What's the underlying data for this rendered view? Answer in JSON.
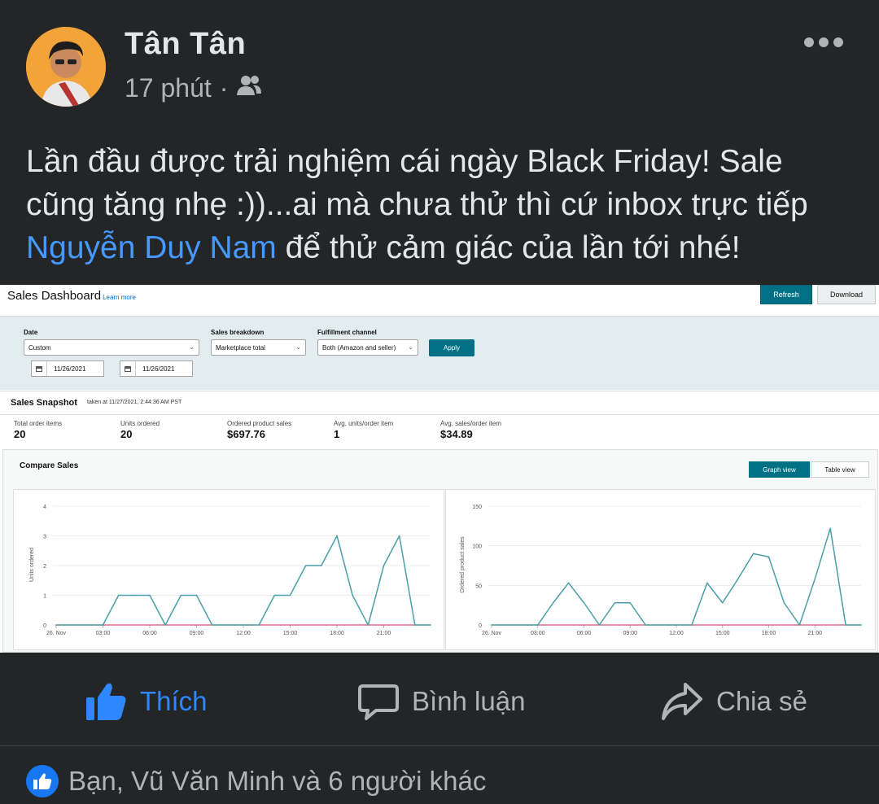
{
  "post": {
    "author": "Tân Tân",
    "time": "17 phút",
    "separator": "·",
    "text_line1": "Lần đầu được trải nghiệm cái ngày Black Friday! Sale",
    "text_line2": "cũng tăng nhẹ :))...ai mà chưa thử thì cứ inbox trực tiếp",
    "mention": "Nguyễn Duy Nam",
    "text_line3_rest": " để thử cảm giác của lần tới nhé!"
  },
  "dashboard": {
    "title": "Sales Dashboard",
    "learn_more": "Learn more",
    "refresh": "Refresh",
    "download": "Download",
    "filters": {
      "date_label": "Date",
      "date_value": "Custom",
      "breakdown_label": "Sales breakdown",
      "breakdown_value": "Marketplace total",
      "channel_label": "Fulfillment channel",
      "channel_value": "Both (Amazon and seller)",
      "apply": "Apply",
      "start_date": "11/26/2021",
      "end_date": "11/26/2021"
    },
    "snapshot": {
      "title": "Sales Snapshot",
      "taken_at": "taken at 11/27/2021, 2:44:36 AM PST",
      "metrics": [
        {
          "label": "Total order items",
          "value": "20"
        },
        {
          "label": "Units ordered",
          "value": "20"
        },
        {
          "label": "Ordered product sales",
          "value": "$697.76"
        },
        {
          "label": "Avg. units/order item",
          "value": "1"
        },
        {
          "label": "Avg. sales/order item",
          "value": "$34.89"
        }
      ]
    },
    "compare": {
      "title": "Compare Sales",
      "graph_view": "Graph view",
      "table_view": "Table view"
    }
  },
  "chart_data": [
    {
      "type": "line",
      "ylabel": "Units ordered",
      "ylim": [
        0,
        4
      ],
      "yticks": [
        "0",
        "1",
        "2",
        "3",
        "4"
      ],
      "xticks": [
        "26. Nov",
        "03:00",
        "06:00",
        "09:00",
        "12:00",
        "15:00",
        "18:00",
        "21:00"
      ],
      "x": [
        0,
        1,
        2,
        3,
        4,
        5,
        6,
        7,
        8,
        9,
        10,
        11,
        12,
        13,
        14,
        15,
        16,
        17,
        18,
        19,
        20,
        21,
        22,
        23,
        24
      ],
      "series": [
        {
          "values": [
            0,
            0,
            0,
            0,
            1,
            1,
            1,
            0,
            1,
            1,
            0,
            0,
            0,
            0,
            1,
            1,
            2,
            2,
            3,
            1,
            0,
            2,
            3,
            0,
            0
          ],
          "color": "#4a9fa8"
        }
      ],
      "baseline_color": "#d0506a"
    },
    {
      "type": "line",
      "ylabel": "Ordered product sales",
      "ylim": [
        0,
        150
      ],
      "yticks": [
        "0",
        "50",
        "100",
        "150"
      ],
      "xticks": [
        "26. Nov",
        "03:00",
        "06:00",
        "09:00",
        "12:00",
        "15:00",
        "18:00",
        "21:00"
      ],
      "x": [
        0,
        1,
        2,
        3,
        4,
        5,
        6,
        7,
        8,
        9,
        10,
        11,
        12,
        13,
        14,
        15,
        16,
        17,
        18,
        19,
        20,
        21,
        22,
        23,
        24
      ],
      "series": [
        {
          "values": [
            0,
            0,
            0,
            0,
            28,
            53,
            28,
            0,
            28,
            28,
            0,
            0,
            0,
            0,
            53,
            28,
            58,
            90,
            86,
            28,
            0,
            58,
            122,
            0,
            0
          ],
          "color": "#4a9fa8"
        }
      ],
      "baseline_color": "#d0506a"
    }
  ],
  "actions": {
    "like": "Thích",
    "comment": "Bình luận",
    "share": "Chia sẻ"
  },
  "reactions": {
    "summary": "Bạn, Vũ Văn Minh và 6 người khác"
  },
  "colors": {
    "background": "#242526",
    "link": "#4599ff",
    "like_active": "#2d88ff",
    "teal": "#007185"
  }
}
